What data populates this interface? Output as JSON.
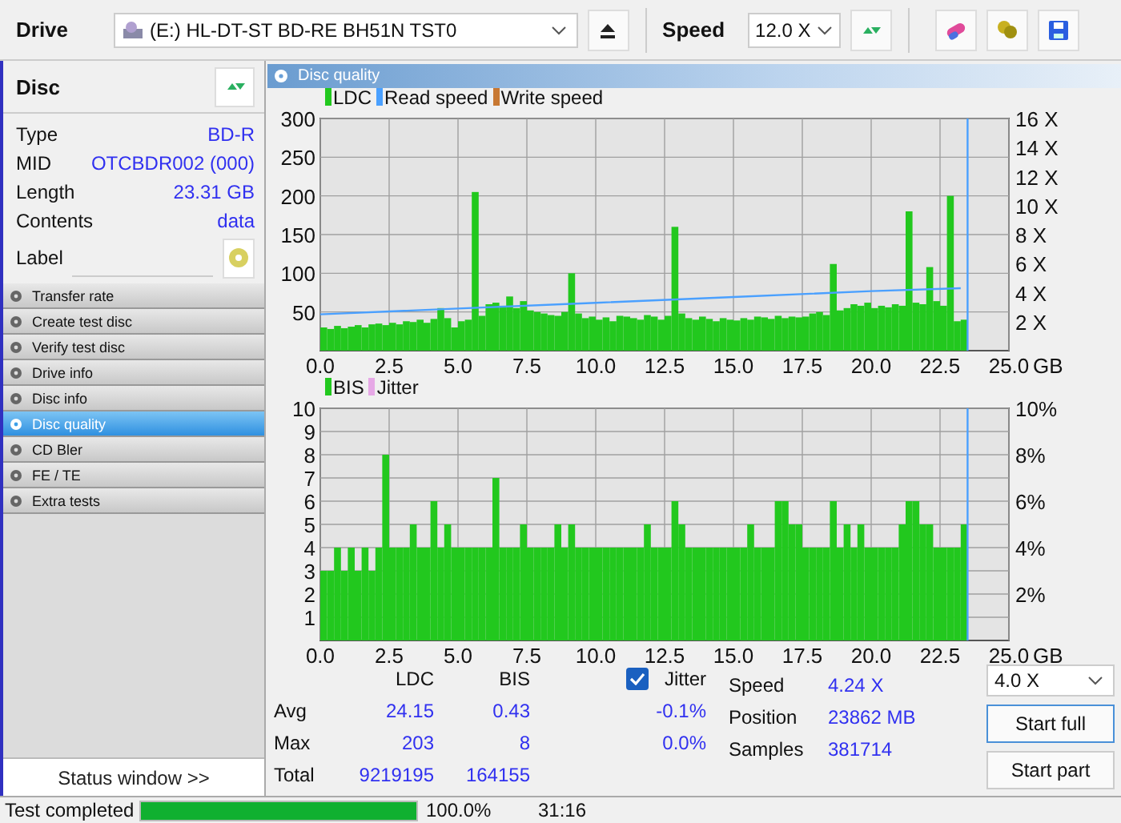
{
  "toolbar": {
    "drive_label": "Drive",
    "drive": "(E:)  HL-DT-ST BD-RE  BH51N TST0",
    "speed_label": "Speed",
    "speed": "12.0 X"
  },
  "disc": {
    "title": "Disc",
    "fields": [
      {
        "label": "Type",
        "value": "BD-R"
      },
      {
        "label": "MID",
        "value": "OTCBDR002 (000)"
      },
      {
        "label": "Length",
        "value": "23.31 GB"
      },
      {
        "label": "Contents",
        "value": "data"
      }
    ],
    "label_field": "Label"
  },
  "nav": [
    {
      "label": "Transfer rate",
      "selected": false
    },
    {
      "label": "Create test disc",
      "selected": false
    },
    {
      "label": "Verify test disc",
      "selected": false
    },
    {
      "label": "Drive info",
      "selected": false
    },
    {
      "label": "Disc info",
      "selected": false
    },
    {
      "label": "Disc quality",
      "selected": true
    },
    {
      "label": "CD Bler",
      "selected": false
    },
    {
      "label": "FE / TE",
      "selected": false
    },
    {
      "label": "Extra tests",
      "selected": false
    }
  ],
  "status_window": "Status window >>",
  "panel_title": "Disc quality",
  "charts": [
    {
      "chart_data": {
        "type": "bar",
        "legend": "top-left",
        "grid": true,
        "ref_lines": [
          {
            "axis": "x",
            "value": 23.5,
            "color": "#4aa0ff"
          }
        ],
        "xlim": [
          0,
          25
        ],
        "ylim": [
          0,
          300
        ],
        "y2lim": [
          0,
          16
        ],
        "xlabel": "GB",
        "x": [
          0,
          0.25,
          0.5,
          0.75,
          1,
          1.25,
          1.5,
          1.75,
          2,
          2.25,
          2.5,
          2.75,
          3,
          3.25,
          3.5,
          3.75,
          4,
          4.25,
          4.5,
          4.75,
          5,
          5.25,
          5.5,
          5.75,
          6,
          6.25,
          6.5,
          6.75,
          7,
          7.25,
          7.5,
          7.75,
          8,
          8.25,
          8.5,
          8.75,
          9,
          9.25,
          9.5,
          9.75,
          10,
          10.25,
          10.5,
          10.75,
          11,
          11.25,
          11.5,
          11.75,
          12,
          12.25,
          12.5,
          12.75,
          13,
          13.25,
          13.5,
          13.75,
          14,
          14.25,
          14.5,
          14.75,
          15,
          15.25,
          15.5,
          15.75,
          16,
          16.25,
          16.5,
          16.75,
          17,
          17.25,
          17.5,
          17.75,
          18,
          18.25,
          18.5,
          18.75,
          19,
          19.25,
          19.5,
          19.75,
          20,
          20.25,
          20.5,
          20.75,
          21,
          21.25,
          21.5,
          21.75,
          22,
          22.25,
          22.5,
          22.75,
          23,
          23.25
        ],
        "xticks": [
          {
            "value": 0,
            "label": "0.0"
          },
          {
            "value": 2.5,
            "label": "2.5"
          },
          {
            "value": 5,
            "label": "5.0"
          },
          {
            "value": 7.5,
            "label": "7.5"
          },
          {
            "value": 10,
            "label": "10.0"
          },
          {
            "value": 12.5,
            "label": "12.5"
          },
          {
            "value": 15,
            "label": "15.0"
          },
          {
            "value": 17.5,
            "label": "17.5"
          },
          {
            "value": 20,
            "label": "20.0"
          },
          {
            "value": 22.5,
            "label": "22.5"
          },
          {
            "value": 25,
            "label": "25.0"
          }
        ],
        "yticks": [
          50,
          100,
          150,
          200,
          250,
          300
        ],
        "y2ticks": [
          {
            "value": 2,
            "label": "2 X"
          },
          {
            "value": 4,
            "label": "4 X"
          },
          {
            "value": 6,
            "label": "6 X"
          },
          {
            "value": 8,
            "label": "8 X"
          },
          {
            "value": 10,
            "label": "10 X"
          },
          {
            "value": 12,
            "label": "12 X"
          },
          {
            "value": 14,
            "label": "14 X"
          },
          {
            "value": 16,
            "label": "16 X"
          }
        ],
        "series": [
          {
            "name": "LDC",
            "color": "#22c81e",
            "values": [
              30,
              28,
              32,
              29,
              31,
              33,
              30,
              34,
              35,
              33,
              36,
              34,
              38,
              37,
              40,
              36,
              41,
              55,
              42,
              30,
              38,
              40,
              205,
              45,
              60,
              62,
              58,
              70,
              55,
              64,
              52,
              50,
              48,
              46,
              45,
              50,
              100,
              48,
              42,
              44,
              40,
              43,
              38,
              45,
              44,
              42,
              40,
              46,
              44,
              40,
              45,
              160,
              48,
              42,
              40,
              44,
              41,
              38,
              42,
              40,
              39,
              42,
              40,
              44,
              43,
              41,
              45,
              42,
              44,
              43,
              44,
              48,
              50,
              46,
              112,
              52,
              55,
              60,
              58,
              62,
              55,
              58,
              56,
              60,
              58,
              180,
              62,
              60,
              108,
              64,
              58,
              200,
              38,
              40
            ]
          },
          {
            "name": "Read speed",
            "color": "#4aa0ff",
            "type": "line",
            "axis": "y2",
            "x": [
              0,
              5,
              10,
              15,
              20,
              23.25
            ],
            "values": [
              2.5,
              2.9,
              3.3,
              3.7,
              4.1,
              4.3
            ]
          }
        ]
      },
      "legend_extra": [
        {
          "label": "Write speed",
          "color": "#c87832"
        }
      ]
    },
    {
      "chart_data": {
        "type": "bar",
        "legend": "top-left",
        "grid": true,
        "ref_lines": [
          {
            "axis": "x",
            "value": 23.5,
            "color": "#4aa0ff"
          }
        ],
        "xlim": [
          0,
          25
        ],
        "ylim": [
          0,
          10
        ],
        "y2lim": [
          0,
          10
        ],
        "xlabel": "GB",
        "x": [
          0,
          0.25,
          0.5,
          0.75,
          1,
          1.25,
          1.5,
          1.75,
          2,
          2.25,
          2.5,
          2.75,
          3,
          3.25,
          3.5,
          3.75,
          4,
          4.25,
          4.5,
          4.75,
          5,
          5.25,
          5.5,
          5.75,
          6,
          6.25,
          6.5,
          6.75,
          7,
          7.25,
          7.5,
          7.75,
          8,
          8.25,
          8.5,
          8.75,
          9,
          9.25,
          9.5,
          9.75,
          10,
          10.25,
          10.5,
          10.75,
          11,
          11.25,
          11.5,
          11.75,
          12,
          12.25,
          12.5,
          12.75,
          13,
          13.25,
          13.5,
          13.75,
          14,
          14.25,
          14.5,
          14.75,
          15,
          15.25,
          15.5,
          15.75,
          16,
          16.25,
          16.5,
          16.75,
          17,
          17.25,
          17.5,
          17.75,
          18,
          18.25,
          18.5,
          18.75,
          19,
          19.25,
          19.5,
          19.75,
          20,
          20.25,
          20.5,
          20.75,
          21,
          21.25,
          21.5,
          21.75,
          22,
          22.25,
          22.5,
          22.75,
          23,
          23.25
        ],
        "xticks": [
          {
            "value": 0,
            "label": "0.0"
          },
          {
            "value": 2.5,
            "label": "2.5"
          },
          {
            "value": 5,
            "label": "5.0"
          },
          {
            "value": 7.5,
            "label": "7.5"
          },
          {
            "value": 10,
            "label": "10.0"
          },
          {
            "value": 12.5,
            "label": "12.5"
          },
          {
            "value": 15,
            "label": "15.0"
          },
          {
            "value": 17.5,
            "label": "17.5"
          },
          {
            "value": 20,
            "label": "20.0"
          },
          {
            "value": 22.5,
            "label": "22.5"
          },
          {
            "value": 25,
            "label": "25.0"
          }
        ],
        "yticks": [
          1,
          2,
          3,
          4,
          5,
          6,
          7,
          8,
          9,
          10
        ],
        "y2ticks": [
          {
            "value": 2,
            "label": "2%"
          },
          {
            "value": 4,
            "label": "4%"
          },
          {
            "value": 6,
            "label": "6%"
          },
          {
            "value": 8,
            "label": "8%"
          },
          {
            "value": 10,
            "label": "10%"
          }
        ],
        "series": [
          {
            "name": "BIS",
            "color": "#22c81e",
            "values": [
              3,
              3,
              4,
              3,
              4,
              3,
              4,
              3,
              4,
              8,
              4,
              4,
              4,
              5,
              4,
              4,
              6,
              4,
              5,
              4,
              4,
              4,
              4,
              4,
              4,
              7,
              4,
              4,
              4,
              5,
              4,
              4,
              4,
              4,
              5,
              4,
              5,
              4,
              4,
              4,
              4,
              4,
              4,
              4,
              4,
              4,
              4,
              5,
              4,
              4,
              4,
              6,
              5,
              4,
              4,
              4,
              4,
              4,
              4,
              4,
              4,
              4,
              5,
              4,
              4,
              4,
              6,
              6,
              5,
              5,
              4,
              4,
              4,
              4,
              6,
              4,
              5,
              4,
              5,
              4,
              4,
              4,
              4,
              4,
              5,
              6,
              6,
              5,
              5,
              4,
              4,
              4,
              4,
              5
            ]
          }
        ]
      },
      "legend_extra": [
        {
          "label": "Jitter",
          "color": "#e6a8e6"
        }
      ]
    }
  ],
  "stats": {
    "columns": [
      "LDC",
      "BIS"
    ],
    "rows": [
      {
        "label": "Avg",
        "values": [
          "24.15",
          "0.43"
        ],
        "jitter": "-0.1%"
      },
      {
        "label": "Max",
        "values": [
          "203",
          "8"
        ],
        "jitter": "0.0%"
      },
      {
        "label": "Total",
        "values": [
          "9219195",
          "164155"
        ]
      }
    ],
    "jitter": {
      "label": "Jitter",
      "checked": true
    },
    "info": [
      {
        "label": "Speed",
        "value": "4.24 X"
      },
      {
        "label": "Position",
        "value": "23862 MB"
      },
      {
        "label": "Samples",
        "value": "381714"
      }
    ],
    "speed": "4.0 X",
    "buttons": [
      "Start full",
      "Start part"
    ]
  },
  "status_bar": {
    "text": "Test completed",
    "level": 1.0,
    "percent": "100.0%",
    "time": "31:16"
  }
}
